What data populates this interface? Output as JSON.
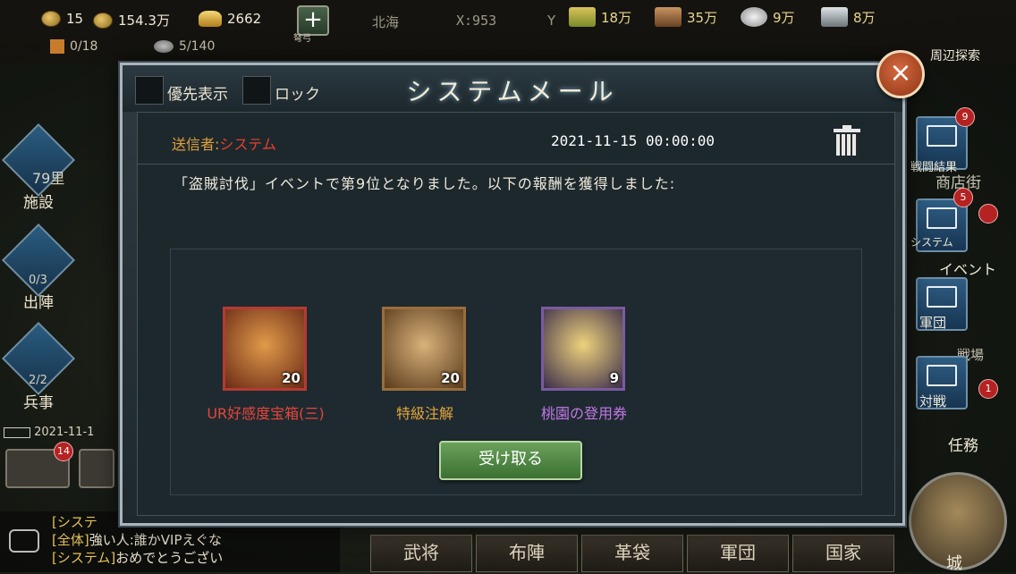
{
  "topbar": {
    "coins_partial": "15",
    "coins": "154.3万",
    "gold": "2662",
    "plus_label": "+",
    "plus_sub": "弩弓",
    "location": "北海",
    "x_coord": "X:953",
    "y_coord": "Y",
    "grain": "18万",
    "wood": "35万",
    "stone": "9万",
    "iron": "8万",
    "troops_partial": "0/18",
    "troops_slots": "5/140"
  },
  "left": {
    "distance": "79里",
    "facility": "施設",
    "sortie_count": "0/3",
    "sortie": "出陣",
    "soldier_count": "2/2",
    "soldier": "兵事",
    "timestamp_partial": "2021-11-1",
    "mail_badge": "14"
  },
  "right": {
    "explore": "周辺探索",
    "battle_result": "戦闘結果",
    "battle_badge": "9",
    "shop": "商店街",
    "system": "システム",
    "system_badge": "5",
    "event": "イベント",
    "corps": "軍団",
    "arena": "戦場",
    "versus": "対戦",
    "versus_badge": "1",
    "mission": "任務",
    "city": "城"
  },
  "bottom_tabs": [
    "武将",
    "布陣",
    "革袋",
    "軍団",
    "国家"
  ],
  "chat": [
    {
      "tag": "[システ",
      "text": ""
    },
    {
      "tag": "[全体]",
      "text": "強い人:誰かVIPえぐな"
    },
    {
      "tag": "[システム]",
      "text": "おめでとうござい"
    }
  ],
  "dialog": {
    "title": "システムメール",
    "priority_label": "優先表示",
    "lock_label": "ロック",
    "close_label": "×",
    "sender_prefix": "送信者:",
    "sender_name": "システム",
    "date": "2021-11-15 00:00:00",
    "body": "「盗賊討伐」イベントで第9位となりました。以下の報酬を獲得しました:",
    "claim_label": "受け取る",
    "rewards": [
      {
        "name": "UR好感度宝箱(三)",
        "count": "20",
        "color": "#e8453a",
        "frame": "#b53a34"
      },
      {
        "name": "特級注解",
        "count": "20",
        "color": "#e5a63e",
        "frame": "#9a6e3b"
      },
      {
        "name": "桃園の登用券",
        "count": "9",
        "color": "#c277e6",
        "frame": "#7b5aa0"
      }
    ]
  }
}
